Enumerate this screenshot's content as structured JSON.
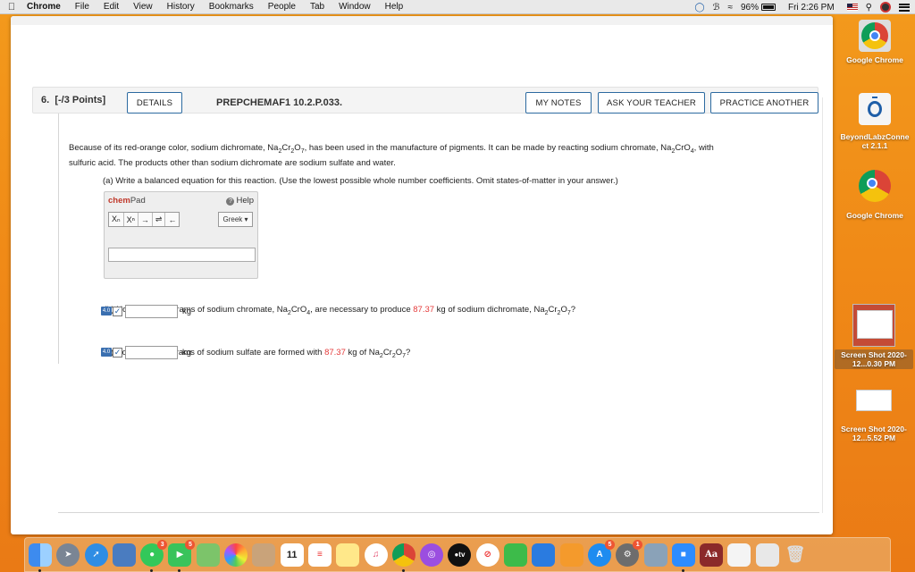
{
  "menubar": {
    "apple": "",
    "app": "Chrome",
    "items": [
      "File",
      "Edit",
      "View",
      "History",
      "Bookmarks",
      "People",
      "Tab",
      "Window",
      "Help"
    ],
    "battery": "96%",
    "clock": "Fri 2:26 PM"
  },
  "question": {
    "number": "6.",
    "points": "[-/3 Points]",
    "details_label": "DETAILS",
    "code": "PREPCHEMAF1 10.2.P.033.",
    "my_notes_label": "MY NOTES",
    "ask_teacher_label": "ASK YOUR TEACHER",
    "practice_label": "PRACTICE ANOTHER",
    "intro_1": "Because of its red-orange color, sodium dichromate, Na",
    "intro_2": ", has been used in the manufacture of pigments. It can be made by reacting sodium chromate, Na",
    "intro_3": ", with",
    "intro_line2": "sulfuric acid. The products other than sodium dichromate are sodium sulfate and water.",
    "part_a": "(a) Write a balanced equation for this reaction. (Use the lowest possible whole number coefficients. Omit states-of-matter in your answer.)",
    "part_b_1": "(b) How many kilograms of sodium chromate, Na",
    "part_b_2": ", are necessary to produce ",
    "part_b_value": "87.37",
    "part_b_3": " kg of sodium dichromate, Na",
    "part_b_4": "?",
    "part_c_1": "(c) How many kilograms of sodium sulfate are formed with ",
    "part_c_value": "87.37",
    "part_c_2": " kg of Na",
    "part_c_3": "?",
    "unit": "kg",
    "value_color": "#e43a3a"
  },
  "chempad": {
    "brand_chem": "chem",
    "brand_pad": "Pad",
    "help_label": "Help",
    "tools": [
      "Xₙ",
      "Xⁿ",
      "→",
      "⇌",
      "←"
    ],
    "greek_label": "Greek ▾"
  },
  "desktop": {
    "icons": [
      {
        "label": "Google Chrome",
        "icon": "chrome-icon"
      },
      {
        "label": "BeyondLabzConne ct 2.1.1",
        "icon": "beyondlabz-icon"
      },
      {
        "label": "Google Chrome",
        "icon": "chrome-icon"
      },
      {
        "label": "Screen Shot 2020-12...0.30 PM",
        "icon": "screenshot-icon"
      },
      {
        "label": "Screen Shot 2020-12...5.52 PM",
        "icon": "screenshot-icon"
      }
    ]
  },
  "dock": {
    "calendar_day": "11",
    "tv_label": "●tv",
    "badges": {
      "messages": "3",
      "contacts": "5",
      "appstore": "5",
      "settings": "1"
    }
  }
}
